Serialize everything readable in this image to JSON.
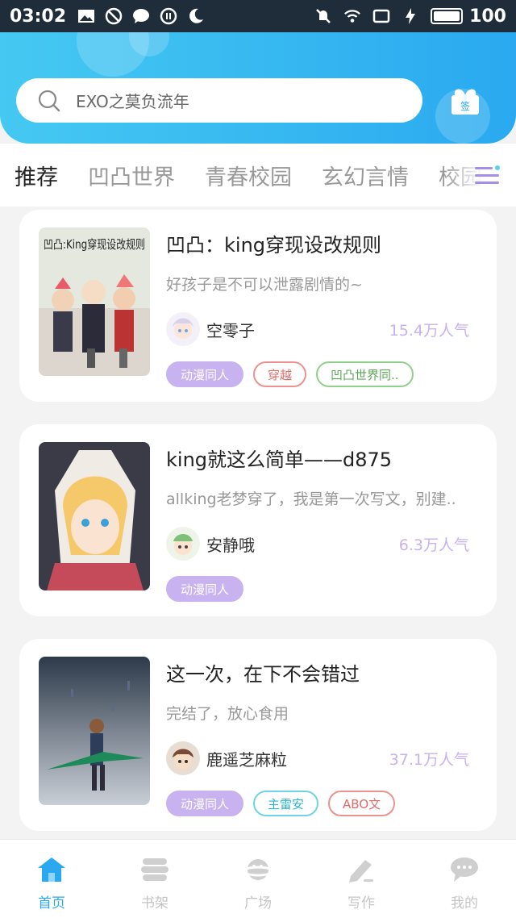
{
  "status_bar": {
    "time": "03:02",
    "battery": "100",
    "left_icons": [
      "image-icon",
      "do-not-disturb-icon",
      "chat-icon",
      "pause-circle-icon",
      "moon-icon"
    ],
    "right_icons": [
      "mute-icon",
      "wifi-icon",
      "rotate-icon",
      "charging-icon",
      "battery-icon"
    ]
  },
  "header": {
    "search_placeholder": "EXO之莫负流年",
    "signin_label": "签",
    "accent_color": "#2aa9f0"
  },
  "tabs": [
    {
      "label": "推荐",
      "active": true
    },
    {
      "label": "凹凸世界",
      "active": false
    },
    {
      "label": "青春校园",
      "active": false
    },
    {
      "label": "玄幻言情",
      "active": false
    },
    {
      "label": "校园",
      "active": false
    }
  ],
  "books": [
    {
      "title": "凹凸：king穿现设改规则",
      "desc": "好孩子是不可以泄露剧情的~",
      "author": "空零子",
      "popularity": "15.4万人气",
      "cover_text": "凹凸:King穿现设改规则",
      "tags": [
        {
          "label": "动漫同人",
          "style": "filled"
        },
        {
          "label": "穿越",
          "style": "red"
        },
        {
          "label": "凹凸世界同..",
          "style": "green"
        }
      ]
    },
    {
      "title": "king就这么简单——d875",
      "desc": "allking老梦穿了，我是第一次写文，别建..",
      "author": "安静哦",
      "popularity": "6.3万人气",
      "tags": [
        {
          "label": "动漫同人",
          "style": "filled"
        }
      ]
    },
    {
      "title": "这一次，在下不会错过",
      "desc": "完结了，放心食用",
      "author": "鹿遥芝麻粒",
      "popularity": "37.1万人气",
      "tags": [
        {
          "label": "动漫同人",
          "style": "filled"
        },
        {
          "label": "主雷安",
          "style": "cyan"
        },
        {
          "label": "ABO文",
          "style": "red"
        }
      ]
    }
  ],
  "bottom_nav": [
    {
      "label": "首页",
      "icon": "home-icon",
      "active": true
    },
    {
      "label": "书架",
      "icon": "bookshelf-icon",
      "active": false
    },
    {
      "label": "广场",
      "icon": "planet-icon",
      "active": false
    },
    {
      "label": "写作",
      "icon": "pen-icon",
      "active": false
    },
    {
      "label": "我的",
      "icon": "profile-chat-icon",
      "active": false
    }
  ]
}
